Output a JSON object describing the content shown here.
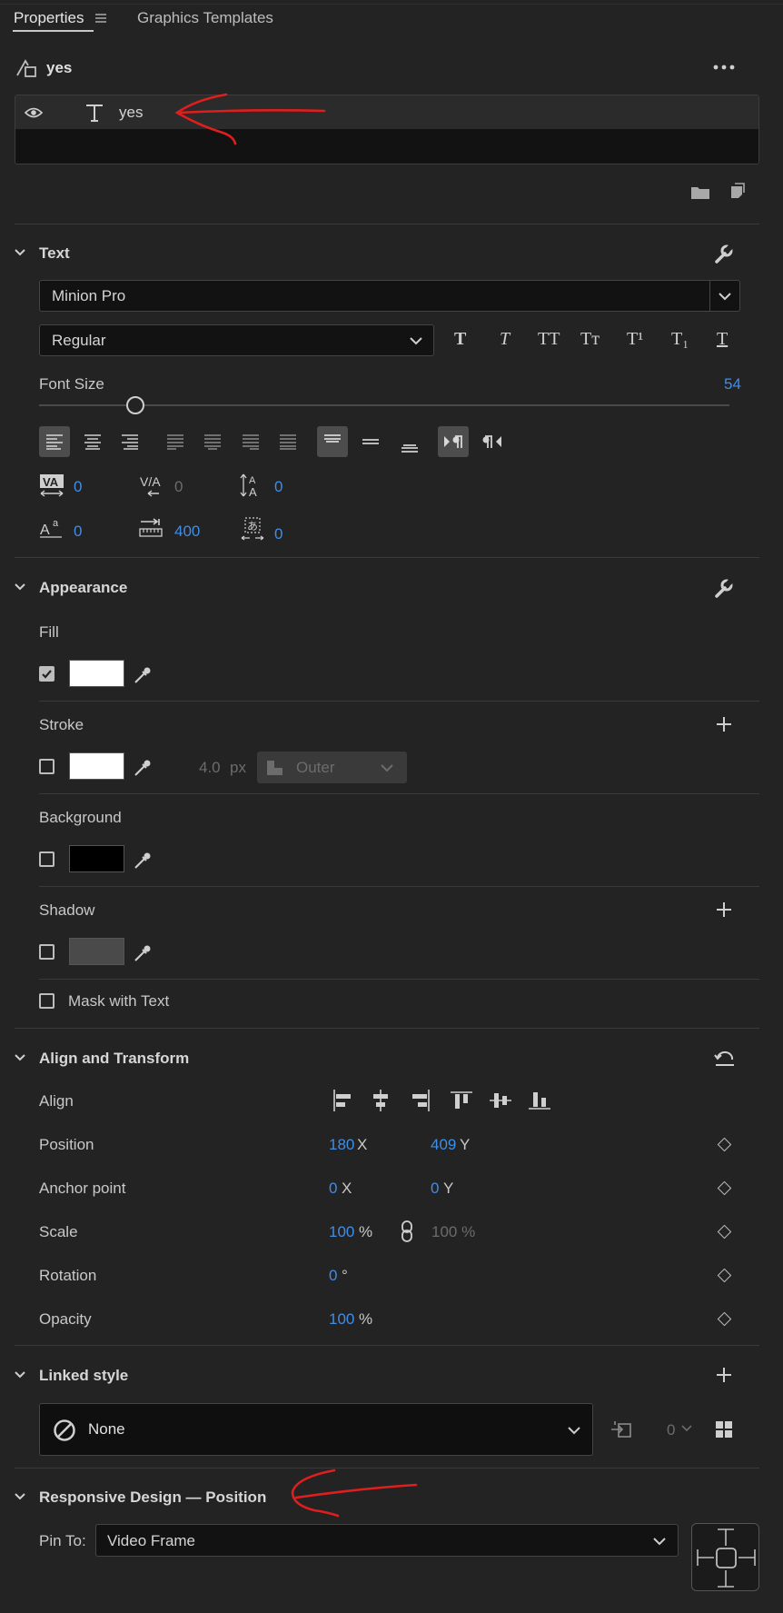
{
  "tabs": {
    "properties": "Properties",
    "graphics_templates": "Graphics Templates"
  },
  "layer_header": {
    "name": "yes"
  },
  "layer_list": [
    {
      "name": "yes"
    }
  ],
  "text_section": {
    "title": "Text",
    "font_family": "Minion Pro",
    "font_style": "Regular",
    "style_buttons": [
      "T",
      "T",
      "TT",
      "Tт",
      "T¹",
      "T₁",
      "T"
    ],
    "font_size_label": "Font Size",
    "font_size_value": "54",
    "font_size_slider_fraction": 0.14,
    "kerning": "0",
    "tracking": "0",
    "leading": "0",
    "baseline_shift": "0",
    "tab_width": "400",
    "tsume": "0"
  },
  "appearance": {
    "title": "Appearance",
    "fill_label": "Fill",
    "fill_color": "#ffffff",
    "fill_checked": true,
    "stroke_label": "Stroke",
    "stroke_color": "#ffffff",
    "stroke_checked": false,
    "stroke_width": "4.0",
    "stroke_unit": "px",
    "stroke_type": "Outer",
    "background_label": "Background",
    "background_color": "#000000",
    "background_checked": false,
    "shadow_label": "Shadow",
    "shadow_color": "#4a4a4a",
    "shadow_checked": false,
    "mask_label": "Mask with Text",
    "mask_checked": false
  },
  "align_transform": {
    "title": "Align and Transform",
    "align_label": "Align",
    "position_label": "Position",
    "position_x": "180",
    "position_y": "409",
    "anchor_label": "Anchor point",
    "anchor_x": "0",
    "anchor_y": "0",
    "scale_label": "Scale",
    "scale_value": "100",
    "scale_unit": "%",
    "scale_h": "100 %",
    "rotation_label": "Rotation",
    "rotation_value": "0",
    "rotation_unit": "°",
    "opacity_label": "Opacity",
    "opacity_value": "100",
    "opacity_unit": "%",
    "x_label": "X",
    "y_label": "Y"
  },
  "linked_style": {
    "title": "Linked style",
    "value": "None",
    "count": "0"
  },
  "responsive": {
    "title": "Responsive Design — Position",
    "pin_label": "Pin To:",
    "pin_value": "Video Frame"
  },
  "colors": {
    "accent": "#3f8ee8",
    "annotation": "#e01e1e",
    "panel_bg": "#232323"
  }
}
